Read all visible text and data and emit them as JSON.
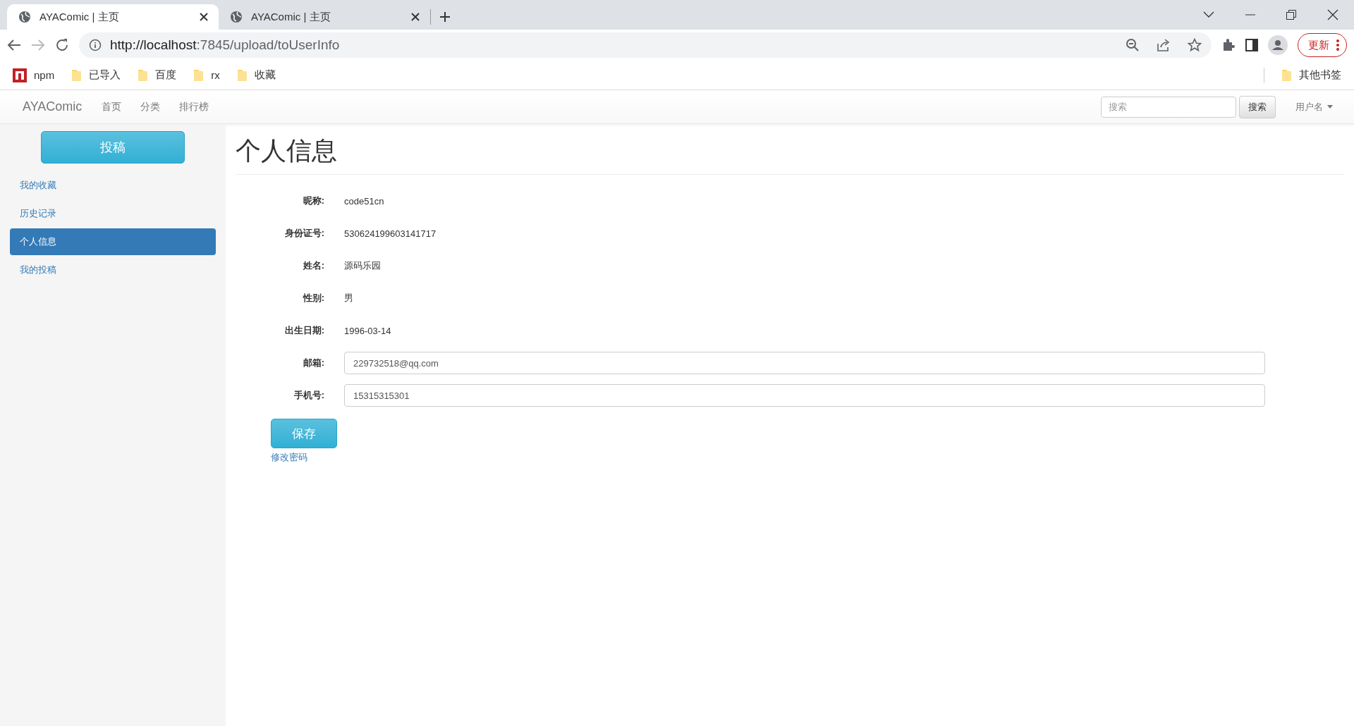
{
  "browser": {
    "tabs": [
      {
        "title": "AYAComic | 主页",
        "selected": true
      },
      {
        "title": "AYAComic | 主页",
        "selected": false
      }
    ],
    "url": {
      "host": "http://localhost",
      "rest": ":7845/upload/toUserInfo"
    },
    "update_button": "更新",
    "bookmarks": [
      {
        "kind": "npm",
        "label": "npm"
      },
      {
        "kind": "folder",
        "label": "已导入"
      },
      {
        "kind": "folder",
        "label": "百度"
      },
      {
        "kind": "folder",
        "label": "rx"
      },
      {
        "kind": "folder",
        "label": "收藏"
      }
    ],
    "other_bookmarks": "其他书签"
  },
  "navbar": {
    "brand": "AYAComic",
    "links": [
      "首页",
      "分类",
      "排行榜"
    ],
    "search": {
      "placeholder": "搜索",
      "button": "搜索"
    },
    "user": "用户名"
  },
  "sidebar": {
    "button": "投稿",
    "items": [
      {
        "label": "我的收藏",
        "selected": false
      },
      {
        "label": "历史记录",
        "selected": false
      },
      {
        "label": "个人信息",
        "selected": true
      },
      {
        "label": "我的投稿",
        "selected": false
      }
    ]
  },
  "main": {
    "title": "个人信息",
    "fields": [
      {
        "kind": "text",
        "label": "昵称:",
        "value": "code51cn"
      },
      {
        "kind": "text",
        "label": "身份证号:",
        "value": "530624199603141717"
      },
      {
        "kind": "text",
        "label": "姓名:",
        "value": "源码乐园"
      },
      {
        "kind": "text",
        "label": "性别:",
        "value": "男"
      },
      {
        "kind": "text",
        "label": "出生日期:",
        "value": "1996-03-14"
      },
      {
        "kind": "input",
        "label": "邮箱:",
        "value": "229732518@qq.com"
      },
      {
        "kind": "input",
        "label": "手机号:",
        "value": "15315315301"
      }
    ],
    "save_button": "保存",
    "change_password_link": "修改密码"
  }
}
